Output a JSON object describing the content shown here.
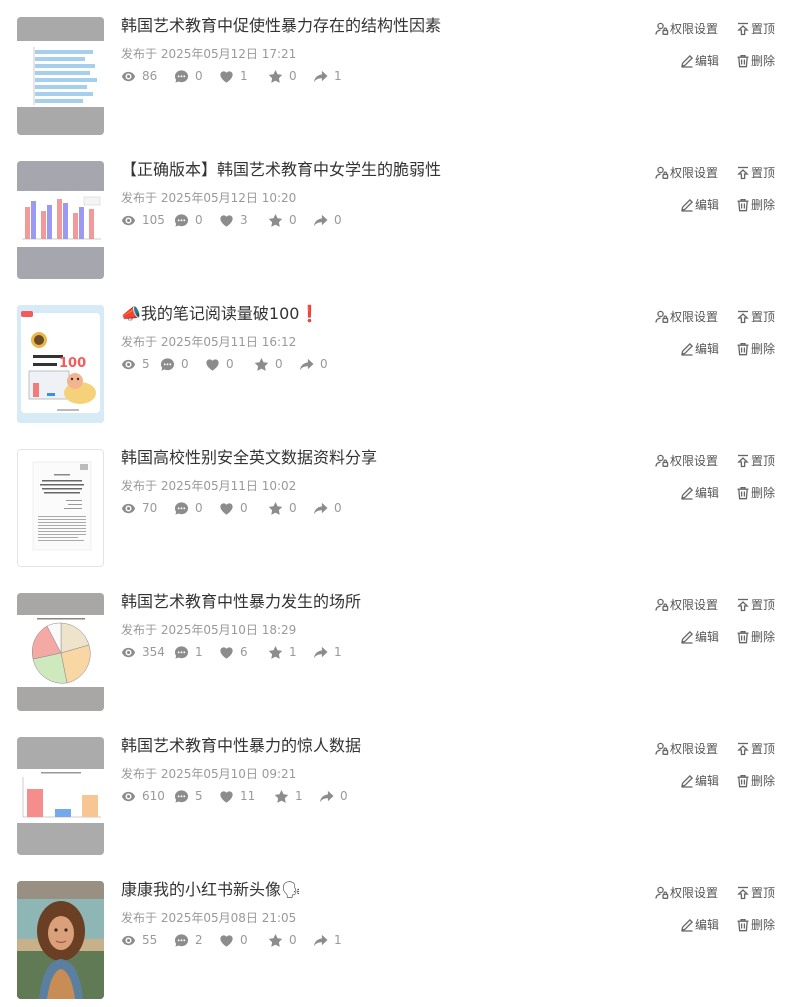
{
  "actions": {
    "permission": "权限设置",
    "pin": "置顶",
    "edit": "编辑",
    "delete": "删除"
  },
  "notes": [
    {
      "title": "韩国艺术教育中促使性暴力存在的结构性因素",
      "date": "发布于 2025年05月12日 17:21",
      "views": "86",
      "comments": "0",
      "likes": "1",
      "collects": "0",
      "shares": "1",
      "thumb": "bar-horizontal"
    },
    {
      "title": "【正确版本】韩国艺术教育中女学生的脆弱性",
      "date": "发布于 2025年05月12日 10:20",
      "views": "105",
      "comments": "0",
      "likes": "3",
      "collects": "0",
      "shares": "0",
      "thumb": "bar-grouped"
    },
    {
      "title": "📣我的笔记阅读量破100❗",
      "date": "发布于 2025年05月11日 16:12",
      "views": "5",
      "comments": "0",
      "likes": "0",
      "collects": "0",
      "shares": "0",
      "thumb": "milestone-card",
      "thumb_text": "100"
    },
    {
      "title": "韩国高校性别安全英文数据资料分享",
      "date": "发布于 2025年05月11日 10:02",
      "views": "70",
      "comments": "0",
      "likes": "0",
      "collects": "0",
      "shares": "0",
      "thumb": "document"
    },
    {
      "title": "韩国艺术教育中性暴力发生的场所",
      "date": "发布于 2025年05月10日 18:29",
      "views": "354",
      "comments": "1",
      "likes": "6",
      "collects": "1",
      "shares": "1",
      "thumb": "pie"
    },
    {
      "title": "韩国艺术教育中性暴力的惊人数据",
      "date": "发布于 2025年05月10日 09:21",
      "views": "610",
      "comments": "5",
      "likes": "11",
      "collects": "1",
      "shares": "0",
      "thumb": "bar-simple"
    },
    {
      "title": "康康我的小红书新头像🗣",
      "date": "发布于 2025年05月08日 21:05",
      "views": "55",
      "comments": "2",
      "likes": "0",
      "collects": "0",
      "shares": "1",
      "thumb": "portrait"
    }
  ]
}
